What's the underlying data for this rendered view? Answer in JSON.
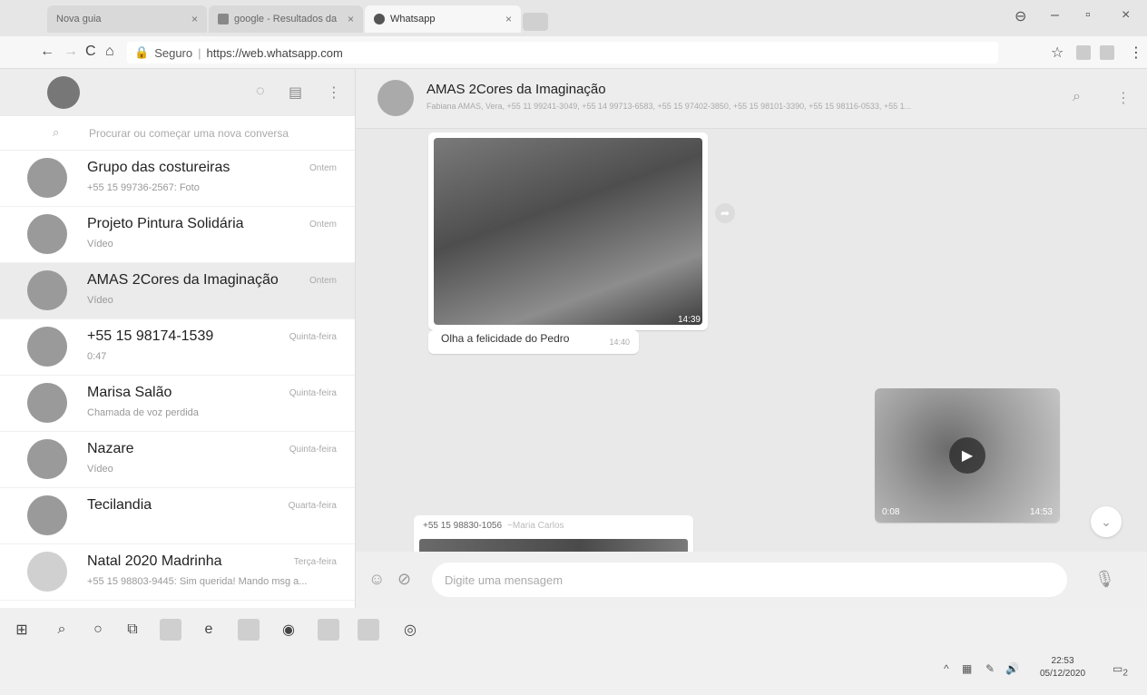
{
  "browser": {
    "tabs": [
      {
        "label": "Nova guia",
        "active": false
      },
      {
        "label": "google - Resultados da",
        "active": false
      },
      {
        "label": "Whatsapp",
        "active": true
      }
    ],
    "secure_label": "Seguro",
    "url": "https://web.whatsapp.com"
  },
  "sidebar": {
    "search_placeholder": "Procurar ou começar uma nova conversa",
    "chats": [
      {
        "name": "Grupo das costureiras",
        "preview": "+55 15 99736-2567: Foto",
        "time": "Ontem"
      },
      {
        "name": "Projeto Pintura Solidária",
        "preview": "Vídeo",
        "time": "Ontem"
      },
      {
        "name": "AMAS 2Cores da Imaginação",
        "preview": "Vídeo",
        "time": "Ontem",
        "selected": true
      },
      {
        "name": "+55 15 98174-1539",
        "preview": "0:47",
        "time": "Quinta-feira"
      },
      {
        "name": "Marisa Salão",
        "preview": "Chamada de voz perdida",
        "time": "Quinta-feira"
      },
      {
        "name": "Nazare",
        "preview": "Vídeo",
        "time": "Quinta-feira"
      },
      {
        "name": "Tecilandia",
        "preview": "",
        "time": "Quarta-feira"
      },
      {
        "name": "Natal 2020 Madrinha",
        "preview": "+55 15 98803-9445: Sim querida! Mando msg a...",
        "time": "Terça-feira"
      }
    ]
  },
  "conversation": {
    "title": "AMAS 2Cores da Imaginação",
    "members": "Fabiana AMAS, Vera, +55 11 99241-3049, +55 14 99713-6583, +55 15 97402-3850, +55 15 98101-3390, +55 15 98116-0533, +55 1...",
    "messages": {
      "photo_time": "14:39",
      "caption": "Olha a felicidade do Pedro",
      "caption_time": "14:40",
      "video_duration": "0:08",
      "video_time": "14:53",
      "sender_number": "+55 15 98830-1056",
      "sender_alias": "~Maria Carlos"
    },
    "composer_placeholder": "Digite uma mensagem"
  },
  "taskbar": {
    "time": "22:53",
    "date": "05/12/2020",
    "notification_count": "2"
  }
}
